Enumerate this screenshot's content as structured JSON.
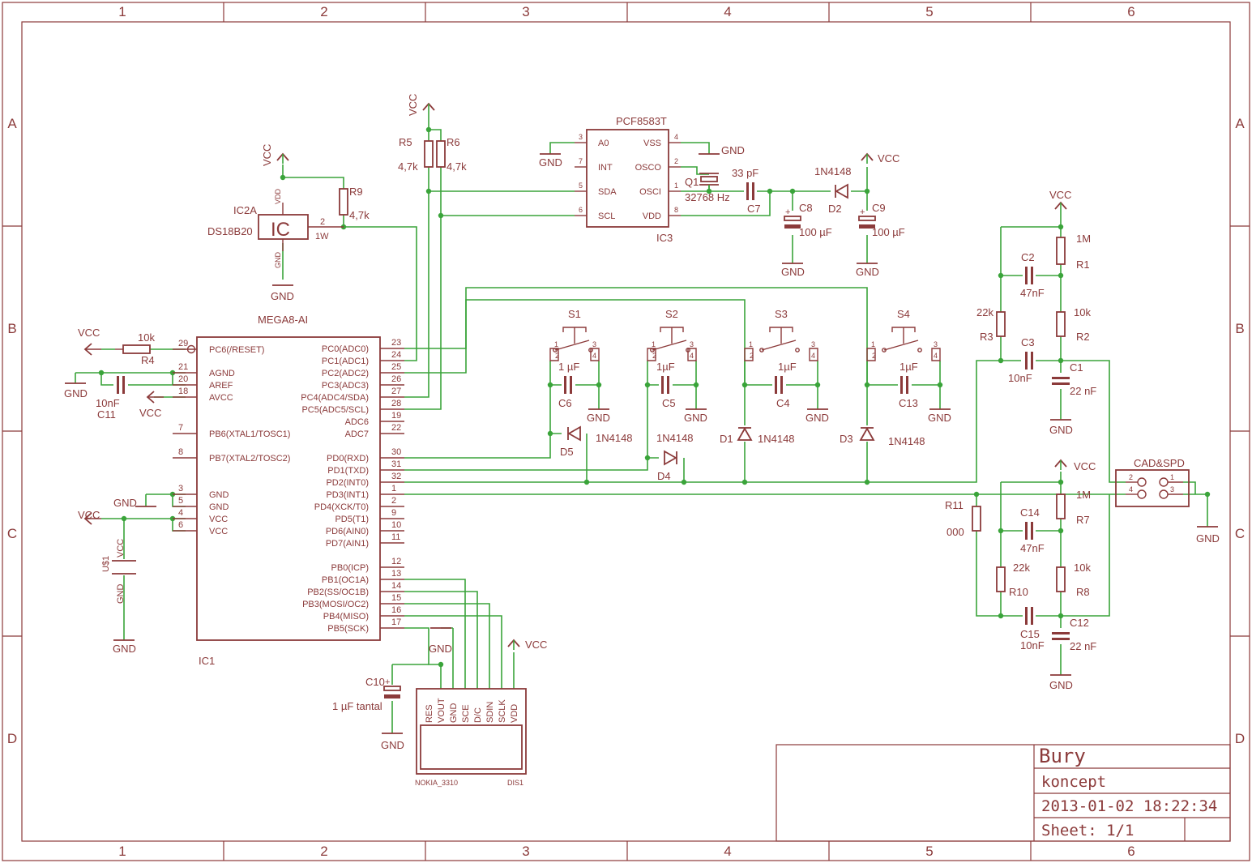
{
  "frame": {
    "columns": [
      "1",
      "2",
      "3",
      "4",
      "5",
      "6"
    ],
    "rows": [
      "A",
      "B",
      "C",
      "D"
    ]
  },
  "title_block": {
    "title": "Bury",
    "subtitle": "koncept",
    "datetime": "2013-01-02 18:22:34",
    "sheet": "Sheet: 1/1"
  },
  "nets": {
    "vcc": "VCC",
    "gnd": "GND"
  },
  "ic1": {
    "ref": "IC1",
    "value": "MEGA8-AI",
    "left_pins": [
      {
        "num": "29",
        "name": "PC6(/RESET)"
      },
      {
        "num": "21",
        "name": "AGND"
      },
      {
        "num": "20",
        "name": "AREF"
      },
      {
        "num": "18",
        "name": "AVCC"
      },
      {
        "num": "7",
        "name": "PB6(XTAL1/TOSC1)"
      },
      {
        "num": "8",
        "name": "PB7(XTAL2/TOSC2)"
      },
      {
        "num": "3",
        "name": "GND"
      },
      {
        "num": "5",
        "name": "GND"
      },
      {
        "num": "4",
        "name": "VCC"
      },
      {
        "num": "6",
        "name": "VCC"
      }
    ],
    "right_pins": [
      {
        "num": "23",
        "name": "PC0(ADC0)"
      },
      {
        "num": "24",
        "name": "PC1(ADC1)"
      },
      {
        "num": "25",
        "name": "PC2(ADC2)"
      },
      {
        "num": "26",
        "name": "PC3(ADC3)"
      },
      {
        "num": "27",
        "name": "PC4(ADC4/SDA)"
      },
      {
        "num": "28",
        "name": "PC5(ADC5/SCL)"
      },
      {
        "num": "19",
        "name": "ADC6"
      },
      {
        "num": "22",
        "name": "ADC7"
      },
      {
        "num": "30",
        "name": "PD0(RXD)"
      },
      {
        "num": "31",
        "name": "PD1(TXD)"
      },
      {
        "num": "32",
        "name": "PD2(INT0)"
      },
      {
        "num": "1",
        "name": "PD3(INT1)"
      },
      {
        "num": "2",
        "name": "PD4(XCK/T0)"
      },
      {
        "num": "9",
        "name": "PD5(T1)"
      },
      {
        "num": "10",
        "name": "PD6(AIN0)"
      },
      {
        "num": "11",
        "name": "PD7(AIN1)"
      },
      {
        "num": "12",
        "name": "PB0(ICP)"
      },
      {
        "num": "13",
        "name": "PB1(OC1A)"
      },
      {
        "num": "14",
        "name": "PB2(SS/OC1B)"
      },
      {
        "num": "15",
        "name": "PB3(MOSI/OC2)"
      },
      {
        "num": "16",
        "name": "PB4(MISO)"
      },
      {
        "num": "17",
        "name": "PB5(SCK)"
      }
    ]
  },
  "ic3": {
    "ref": "IC3",
    "value": "PCF8583T",
    "left_pins": [
      {
        "num": "3",
        "name": "A0"
      },
      {
        "num": "7",
        "name": "INT"
      },
      {
        "num": "5",
        "name": "SDA"
      },
      {
        "num": "6",
        "name": "SCL"
      }
    ],
    "right_pins": [
      {
        "num": "4",
        "name": "VSS"
      },
      {
        "num": "2",
        "name": "OSCO"
      },
      {
        "num": "1",
        "name": "OSCI"
      },
      {
        "num": "8",
        "name": "VDD"
      }
    ]
  },
  "ic2": {
    "ref": "IC2A",
    "value": "DS18B20",
    "symbol": "IC",
    "pin_vdd": "VDD",
    "pin_gnd": "GND",
    "pin2": "2",
    "pin2_label": "1W"
  },
  "display": {
    "value": "NOKIA_3310",
    "ref": "DIS1",
    "pins": [
      "RES",
      "VOUT",
      "GND",
      "SCE",
      "D/C",
      "SDIN",
      "SCLK",
      "VDD"
    ]
  },
  "connector": {
    "name": "CAD&SPD",
    "pins": [
      "2",
      "4",
      "1",
      "3"
    ]
  },
  "switches": [
    "S1",
    "S2",
    "S3",
    "S4"
  ],
  "switch_pins": [
    "1",
    "2",
    "3",
    "4"
  ],
  "parts": {
    "r4": {
      "ref": "R4",
      "value": "10k"
    },
    "r5": {
      "ref": "R5",
      "value": "4,7k"
    },
    "r6": {
      "ref": "R6",
      "value": "4,7k"
    },
    "r9": {
      "ref": "R9",
      "value": "4,7k"
    },
    "r1": {
      "ref": "R1",
      "value": "1M"
    },
    "r2": {
      "ref": "R2",
      "value": "10k"
    },
    "r3": {
      "ref": "R3",
      "value": "22k"
    },
    "r7": {
      "ref": "R7",
      "value": "1M"
    },
    "r8": {
      "ref": "R8",
      "value": "10k"
    },
    "r10": {
      "ref": "R10",
      "value": "22k"
    },
    "r11": {
      "ref": "R11",
      "value": "000"
    },
    "c11": {
      "ref": "C11",
      "value": "10nF"
    },
    "c6": {
      "ref": "C6",
      "value": "1 µF"
    },
    "c5": {
      "ref": "C5",
      "value": "1µF"
    },
    "c4": {
      "ref": "C4",
      "value": "1µF"
    },
    "c13": {
      "ref": "C13",
      "value": "1µF"
    },
    "c7": {
      "ref": "C7",
      "value": "33 pF"
    },
    "c8": {
      "ref": "C8",
      "value": "100 µF"
    },
    "c9": {
      "ref": "C9",
      "value": "100 µF"
    },
    "c10": {
      "ref": "C10",
      "value": "1 µF tantal"
    },
    "c2": {
      "ref": "C2",
      "value": "47nF"
    },
    "c3": {
      "ref": "C3",
      "value": "10nF"
    },
    "c1": {
      "ref": "C1",
      "value": "22 nF"
    },
    "c14": {
      "ref": "C14",
      "value": "47nF"
    },
    "c15": {
      "ref": "C15",
      "value": "10nF"
    },
    "c12": {
      "ref": "C12",
      "value": "22 nF"
    },
    "q1": {
      "ref": "Q1",
      "value": "32768 Hz"
    },
    "d1": {
      "ref": "D1",
      "value": "1N4148"
    },
    "d2": {
      "ref": "D2",
      "value": "1N4148"
    },
    "d3": {
      "ref": "D3",
      "value": "1N4148"
    },
    "d4": {
      "ref": "D4",
      "value": "1N4148"
    },
    "d5": {
      "ref": "D5",
      "value": "1N4148"
    },
    "u1": {
      "ref": "U$1",
      "pin_vcc": "VCC",
      "pin_gnd": "GND"
    }
  }
}
